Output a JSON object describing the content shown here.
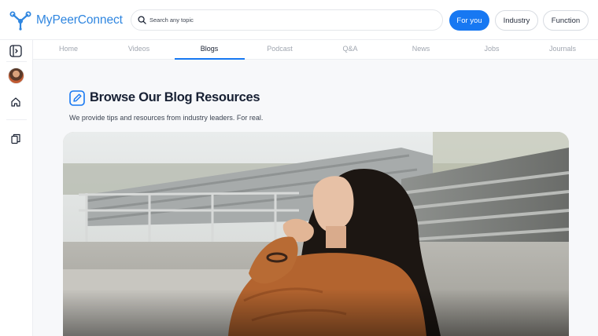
{
  "app": {
    "name": "MyPeerConnect",
    "brand_color": "#2f86e0",
    "accent_color": "#1778f2"
  },
  "search": {
    "placeholder": "Search any topic",
    "value": ""
  },
  "header": {
    "filters": [
      {
        "label": "For you",
        "active": true
      },
      {
        "label": "Industry",
        "active": false
      },
      {
        "label": "Function",
        "active": false
      }
    ]
  },
  "rail": {
    "icons": [
      "sidebar-toggle-icon",
      "avatar",
      "home-icon",
      "library-icon"
    ]
  },
  "tabs": [
    {
      "label": "Home",
      "active": false
    },
    {
      "label": "Videos",
      "active": false
    },
    {
      "label": "Blogs",
      "active": true
    },
    {
      "label": "Podcast",
      "active": false
    },
    {
      "label": "Q&A",
      "active": false
    },
    {
      "label": "News",
      "active": false
    },
    {
      "label": "Jobs",
      "active": false
    },
    {
      "label": "Journals",
      "active": false
    }
  ],
  "main": {
    "title": "Browse Our Blog Resources",
    "subtitle": "We provide tips and resources from industry leaders. For real."
  }
}
